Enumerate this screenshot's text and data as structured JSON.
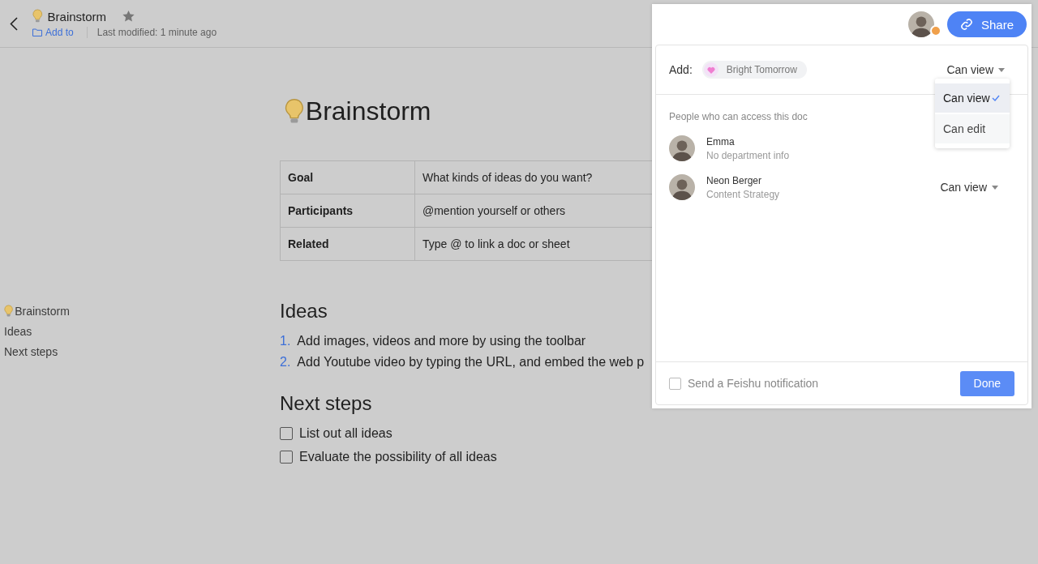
{
  "header": {
    "title": "Brainstorm",
    "starred": true,
    "add_to": "Add to",
    "last_modified": "Last modified: 1 minute ago"
  },
  "outline": [
    {
      "label": "Brainstorm",
      "kind": "title"
    },
    {
      "label": "Ideas",
      "kind": "heading"
    },
    {
      "label": "Next steps",
      "kind": "heading"
    }
  ],
  "doc": {
    "title": "Brainstorm",
    "table": [
      {
        "label": "Goal",
        "value": "What kinds of ideas do you want?"
      },
      {
        "label": "Participants",
        "value": "@mention yourself or others"
      },
      {
        "label": "Related",
        "value": "Type @ to link a doc or sheet"
      }
    ],
    "ideas_heading": "Ideas",
    "ideas": [
      {
        "number": "1.",
        "text": "Add images, videos and more by using the toolbar"
      },
      {
        "number": "2.",
        "text": "Add Youtube video by typing the URL, and embed the web p"
      }
    ],
    "next_heading": "Next steps",
    "tasks": [
      {
        "text": "List out all ideas",
        "checked": false
      },
      {
        "text": "Evaluate the possibility of all ideas",
        "checked": false
      }
    ]
  },
  "share_panel": {
    "share_button": "Share",
    "online": true,
    "add_label": "Add:",
    "add_chip": "Bright Tomorrow",
    "add_permission": "Can view",
    "permission_menu": [
      {
        "label": "Can view",
        "selected": true
      },
      {
        "label": "Can edit",
        "selected": false
      }
    ],
    "people_heading": "People who can access this doc",
    "people": [
      {
        "name": "Emma",
        "detail": "No department info",
        "kind": "owner"
      },
      {
        "name": "Neon Berger",
        "detail": "Content Strategy",
        "role": "Can view",
        "kind": "dropdown"
      }
    ],
    "notify": {
      "label": "Send a Feishu notification",
      "checked": false
    },
    "done": "Done"
  }
}
